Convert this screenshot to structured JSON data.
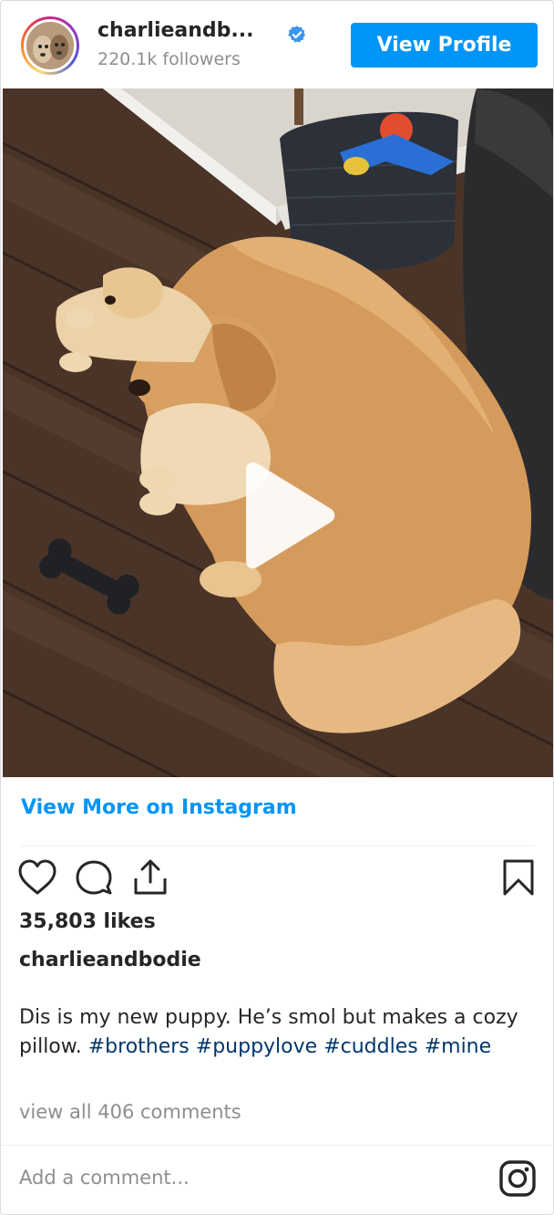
{
  "header": {
    "username": "charlieandb...",
    "followers": "220.1k followers",
    "view_profile_label": "View Profile"
  },
  "media": {
    "type": "video"
  },
  "view_more_label": "View More on Instagram",
  "actions": {
    "icons": [
      "heart-icon",
      "comment-icon",
      "share-icon",
      "bookmark-icon"
    ]
  },
  "likes": "35,803 likes",
  "caption": {
    "username": "charlieandbodie",
    "text": "Dis is my new puppy. He’s smol but makes a cozy pillow. ",
    "hashtags": [
      "#brothers",
      "#puppylove",
      "#cuddles",
      "#mine"
    ]
  },
  "view_comments_label": "view all 406 comments",
  "add_comment_placeholder": "Add a comment...",
  "colors": {
    "accent": "#0095f6",
    "hashtag": "#00376b",
    "secondary_text": "#8e8e8e"
  }
}
